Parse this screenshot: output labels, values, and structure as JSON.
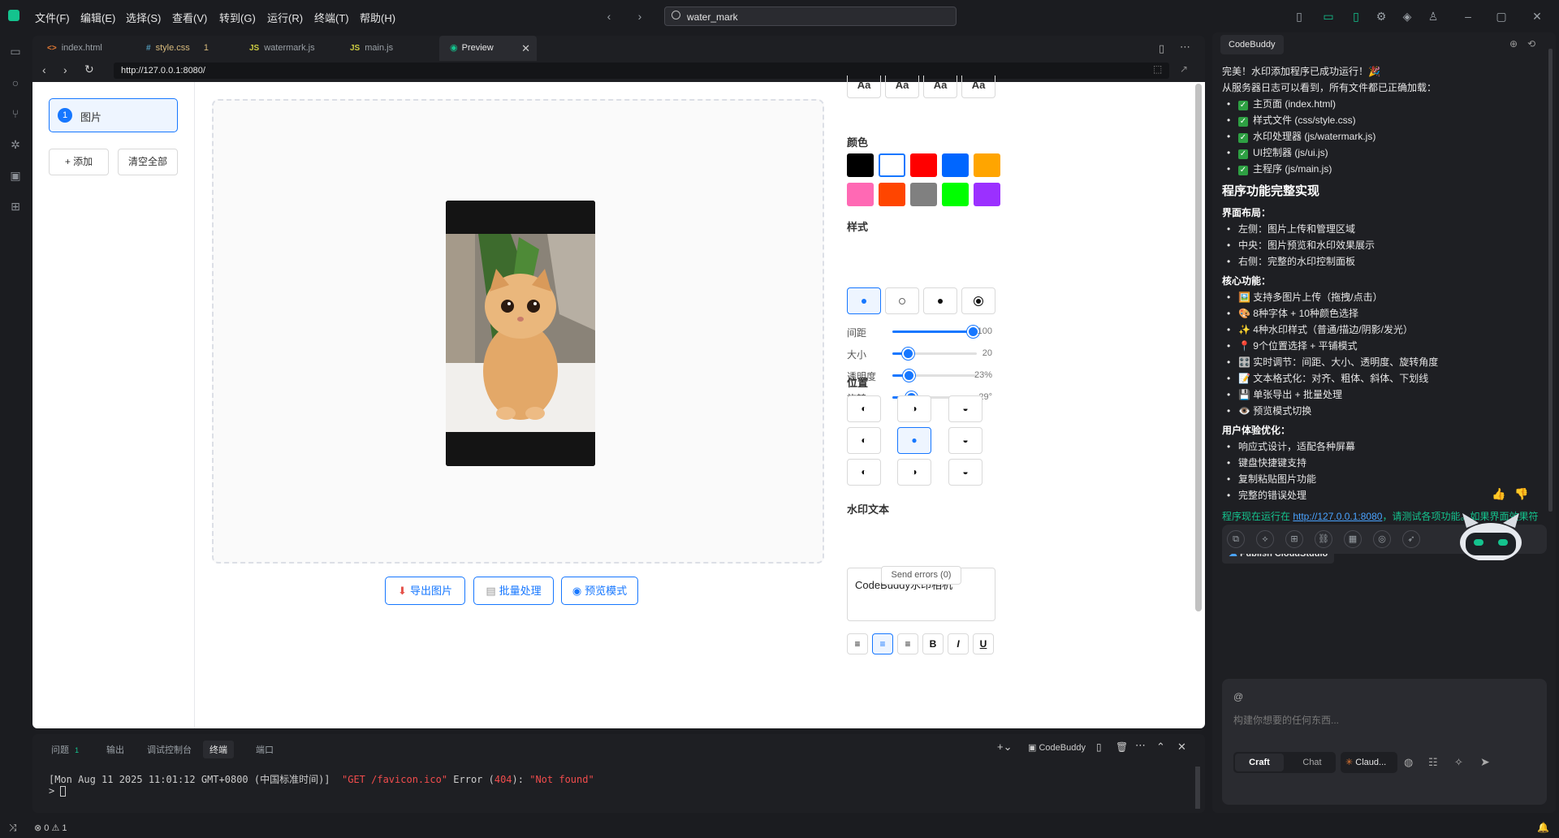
{
  "menu": [
    "文件(F)",
    "编辑(E)",
    "选择(S)",
    "查看(V)",
    "转到(G)",
    "运行(R)",
    "终端(T)",
    "帮助(H)"
  ],
  "search": {
    "value": "water_mark"
  },
  "tabs": [
    {
      "name": "index.html",
      "icon": "<>"
    },
    {
      "name": "style.css",
      "icon": "#",
      "badge": "1"
    },
    {
      "name": "watermark.js",
      "icon": "JS"
    },
    {
      "name": "main.js",
      "icon": "JS"
    },
    {
      "name": "Preview",
      "icon": "eye-icon"
    }
  ],
  "url": "http://127.0.0.1:8080/",
  "left_panel": {
    "image_index": "1",
    "image_label": "图片",
    "add_label": "+ 添加",
    "clear_label": "清空全部"
  },
  "actions": {
    "export": "导出图片",
    "batch": "批量处理",
    "preview": "预览模式"
  },
  "controls": {
    "font_sample": "Aa",
    "color_title": "颜色",
    "colors": [
      "#000000",
      "#ffffff",
      "#ff0000",
      "#0066ff",
      "#ffa500",
      "#ff69b4",
      "#ff4500",
      "#808080",
      "#00ff00",
      "#9b30ff"
    ],
    "style_title": "样式",
    "sliders": [
      {
        "label": "间距",
        "value": "100",
        "fraction": 0.95
      },
      {
        "label": "大小",
        "value": "20",
        "fraction": 0.18
      },
      {
        "label": "透明度",
        "value": "23%",
        "fraction": 0.19
      },
      {
        "label": "旋转",
        "value": "-29°",
        "fraction": 0.22
      }
    ],
    "position_title": "位置",
    "wm_title": "水印文本",
    "wm_text": "CodeBuddy水印相机",
    "format_buttons": [
      "≡",
      "≡",
      "≡",
      "B",
      "I",
      "U"
    ],
    "send_errors": "Send errors (0)"
  },
  "panel": {
    "tabs": [
      "问题",
      "输出",
      "调试控制台",
      "终端",
      "端口"
    ],
    "problem_count": "1",
    "terminal_name": "CodeBuddy",
    "log_prefix": "[Mon Aug 11 2025 11:01:12 GMT+0800 (中国标准时间)]  ",
    "log_get": "\"GET /favicon.ico\"",
    "log_error": " Error (",
    "log_code": "404",
    "log_mid": "): ",
    "log_msg": "\"Not found\"",
    "prompt": ">"
  },
  "status": {
    "errors": "0",
    "warnings": "1"
  },
  "chat": {
    "tab_title": "CodeBuddy",
    "intro": "完美！水印添加程序已成功运行！🎉",
    "intro2": "从服务器日志可以看到，所有文件都已正确加载：",
    "loaded": [
      "主页面 (index.html)",
      "样式文件 (css/style.css)",
      "水印处理器 (js/watermark.js)",
      "UI控制器 (js/ui.js)",
      "主程序 (js/main.js)"
    ],
    "heading": "程序功能完整实现",
    "layout_title": "界面布局：",
    "layout": [
      "左侧：图片上传和管理区域",
      "中央：图片预览和水印效果展示",
      "右侧：完整的水印控制面板"
    ],
    "core_title": "核心功能：",
    "core": [
      "🖼️ 支持多图片上传（拖拽/点击）",
      "🎨 8种字体 + 10种颜色选择",
      "✨ 4种水印样式（普通/描边/阴影/发光）",
      "📍 9个位置选择 + 平铺模式",
      "🎛️ 实时调节：间距、大小、透明度、旋转角度",
      "📝 文本格式化：对齐、粗体、斜体、下划线",
      "💾 单张导出 + 批量处理",
      "👁️ 预览模式切换"
    ],
    "ux_title": "用户体验优化：",
    "ux": [
      "响应式设计，适配各种屏幕",
      "键盘快捷键支持",
      "复制粘贴图片功能",
      "完整的错误处理"
    ],
    "outro_prefix": "程序现在运行在 ",
    "outro_link": "http://127.0.0.1:8080",
    "outro_suffix": "，请测试各项功能。如果界面效果符合预期，我们就完成了这个水印添加工具的开发！",
    "publish": "Publish CloudStudio",
    "input_placeholder": "构建你想要的任何东西...",
    "at_symbol": "@",
    "mode_craft": "Craft",
    "mode_chat": "Chat",
    "model": "Claud..."
  }
}
